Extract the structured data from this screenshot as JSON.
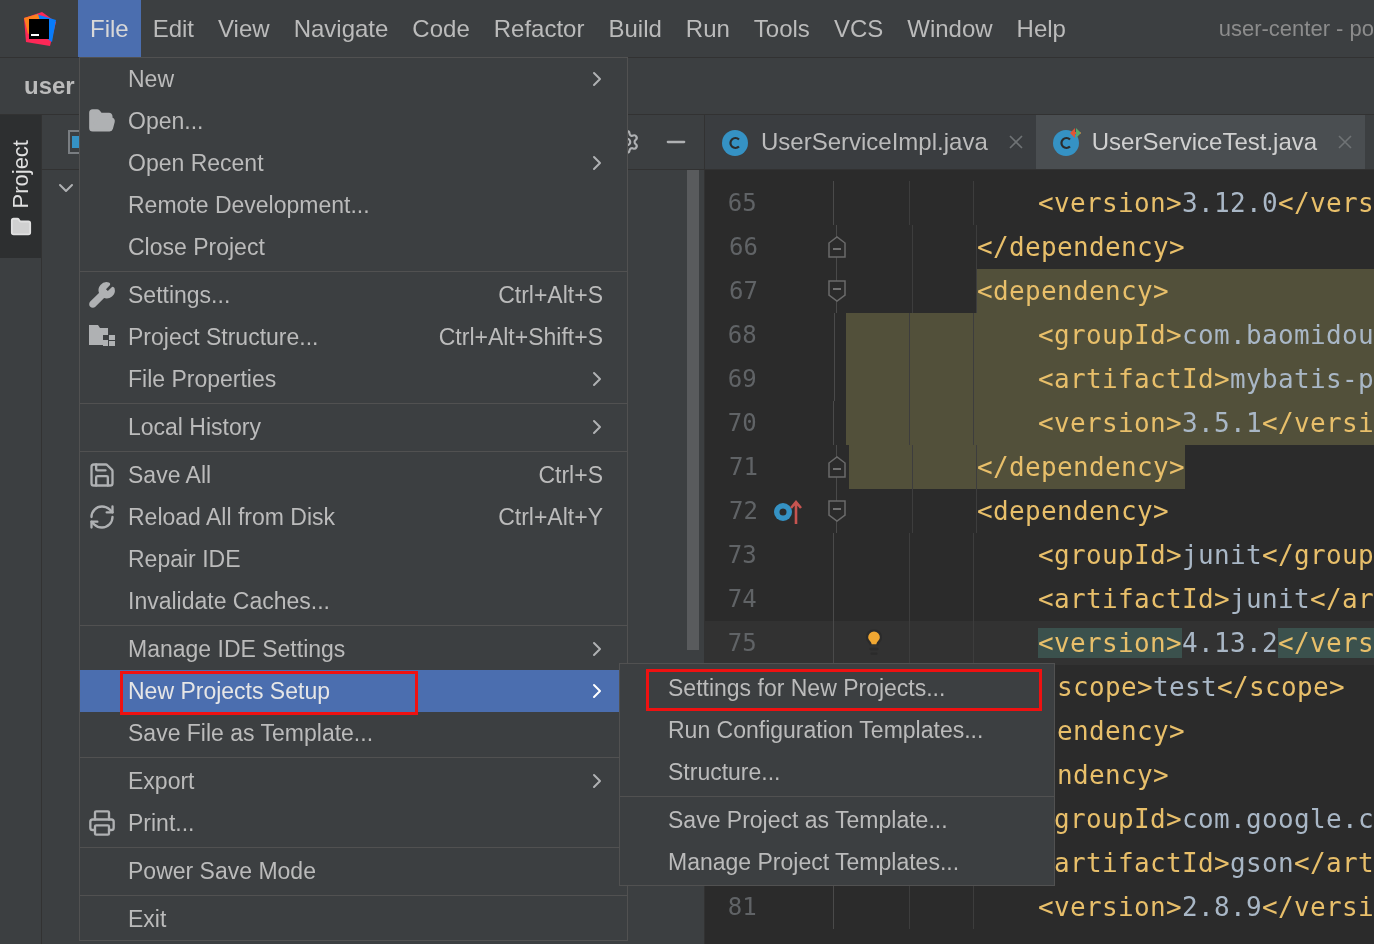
{
  "window": {
    "title": "user-center - po"
  },
  "menubar": [
    {
      "label": "File",
      "selected": true
    },
    {
      "label": "Edit",
      "selected": false
    },
    {
      "label": "View",
      "selected": false
    },
    {
      "label": "Navigate",
      "selected": false
    },
    {
      "label": "Code",
      "selected": false
    },
    {
      "label": "Refactor",
      "selected": false
    },
    {
      "label": "Build",
      "selected": false
    },
    {
      "label": "Run",
      "selected": false
    },
    {
      "label": "Tools",
      "selected": false
    },
    {
      "label": "VCS",
      "selected": false
    },
    {
      "label": "Window",
      "selected": false
    },
    {
      "label": "Help",
      "selected": false
    }
  ],
  "breadcrumb": "user",
  "tool_strip": [
    {
      "label": "Project",
      "selected": true
    }
  ],
  "editor_tabs": [
    {
      "label": "UserServiceImpl.java",
      "selected": false
    },
    {
      "label": "UserServiceTest.java",
      "selected": true
    }
  ],
  "file_menu": [
    {
      "kind": "item",
      "label": "New",
      "submenu": true,
      "selected": false
    },
    {
      "kind": "item",
      "label": "Open...",
      "submenu": false,
      "selected": false
    },
    {
      "kind": "item",
      "label": "Open Recent",
      "submenu": true,
      "selected": false
    },
    {
      "kind": "item",
      "label": "Remote Development...",
      "submenu": false,
      "selected": false
    },
    {
      "kind": "item",
      "label": "Close Project",
      "submenu": false,
      "selected": false
    },
    {
      "kind": "separator"
    },
    {
      "kind": "item",
      "label": "Settings...",
      "shortcut": "Ctrl+Alt+S",
      "submenu": false,
      "selected": false
    },
    {
      "kind": "item",
      "label": "Project Structure...",
      "shortcut": "Ctrl+Alt+Shift+S",
      "submenu": false,
      "selected": false
    },
    {
      "kind": "item",
      "label": "File Properties",
      "submenu": true,
      "selected": false
    },
    {
      "kind": "separator"
    },
    {
      "kind": "item",
      "label": "Local History",
      "submenu": true,
      "selected": false
    },
    {
      "kind": "separator"
    },
    {
      "kind": "item",
      "label": "Save All",
      "shortcut": "Ctrl+S",
      "submenu": false,
      "selected": false
    },
    {
      "kind": "item",
      "label": "Reload All from Disk",
      "shortcut": "Ctrl+Alt+Y",
      "submenu": false,
      "selected": false
    },
    {
      "kind": "item",
      "label": "Repair IDE",
      "submenu": false,
      "selected": false
    },
    {
      "kind": "item",
      "label": "Invalidate Caches...",
      "submenu": false,
      "selected": false
    },
    {
      "kind": "separator"
    },
    {
      "kind": "item",
      "label": "Manage IDE Settings",
      "submenu": true,
      "selected": false
    },
    {
      "kind": "item",
      "label": "New Projects Setup",
      "submenu": true,
      "selected": true,
      "annotated": true
    },
    {
      "kind": "item",
      "label": "Save File as Template...",
      "submenu": false,
      "selected": false
    },
    {
      "kind": "separator"
    },
    {
      "kind": "item",
      "label": "Export",
      "submenu": true,
      "selected": false
    },
    {
      "kind": "item",
      "label": "Print...",
      "submenu": false,
      "selected": false
    },
    {
      "kind": "separator"
    },
    {
      "kind": "item",
      "label": "Power Save Mode",
      "submenu": false,
      "selected": false
    },
    {
      "kind": "separator"
    },
    {
      "kind": "item",
      "label": "Exit",
      "submenu": false,
      "selected": false
    }
  ],
  "submenu": [
    {
      "kind": "item",
      "label": "Settings for New Projects...",
      "annotated": true
    },
    {
      "kind": "item",
      "label": "Run Configuration Templates...",
      "annotated": false
    },
    {
      "kind": "item",
      "label": "Structure...",
      "annotated": false
    },
    {
      "kind": "separator"
    },
    {
      "kind": "item",
      "label": "Save Project as Template...",
      "annotated": false
    },
    {
      "kind": "item",
      "label": "Manage Project Templates...",
      "annotated": false
    }
  ],
  "editor": {
    "lines": [
      {
        "number": "65",
        "code": "            <version>3.12.0</vers",
        "kind": "plain",
        "fold_start": false,
        "fold_end": false,
        "override": false,
        "bulb": false
      },
      {
        "number": "66",
        "code": "        </dependency>",
        "kind": "plain",
        "fold_start": false,
        "fold_end": true,
        "override": false,
        "bulb": false
      },
      {
        "number": "67",
        "code": "        <dependency>",
        "kind": "block-start",
        "fold_start": true,
        "fold_end": false,
        "override": false,
        "bulb": false
      },
      {
        "number": "68",
        "code": "            <groupId>com.baomidou",
        "kind": "block",
        "fold_start": false,
        "fold_end": false,
        "override": false,
        "bulb": false
      },
      {
        "number": "69",
        "code": "            <artifactId>mybatis-p",
        "kind": "block",
        "fold_start": false,
        "fold_end": false,
        "override": false,
        "bulb": false
      },
      {
        "number": "70",
        "code": "            <version>3.5.1</versi",
        "kind": "block",
        "fold_start": false,
        "fold_end": false,
        "override": false,
        "bulb": false
      },
      {
        "number": "71",
        "code": "        </dependency>",
        "kind": "block-end",
        "fold_start": false,
        "fold_end": true,
        "override": false,
        "bulb": false
      },
      {
        "number": "72",
        "code": "        <dependency>",
        "kind": "plain",
        "fold_start": true,
        "fold_end": false,
        "override": true,
        "bulb": false
      },
      {
        "number": "73",
        "code": "            <groupId>junit</group",
        "kind": "plain",
        "fold_start": false,
        "fold_end": false,
        "override": false,
        "bulb": false
      },
      {
        "number": "74",
        "code": "            <artifactId>junit</ar",
        "kind": "plain",
        "fold_start": false,
        "fold_end": false,
        "override": false,
        "bulb": false
      },
      {
        "number": "75",
        "code": "            <version>4.13.2</vers",
        "kind": "caret",
        "fold_start": false,
        "fold_end": false,
        "override": false,
        "bulb": true
      },
      {
        "code": "             scope>test</scope>",
        "kind": "plain"
      },
      {
        "code": "             endency>",
        "kind": "plain"
      },
      {
        "code": "             ndency>",
        "kind": "plain"
      },
      {
        "code": "             groupId>com.google.c",
        "kind": "plain"
      },
      {
        "code": "             artifactId>gson</art",
        "kind": "plain"
      },
      {
        "number": "81",
        "code": "            <version>2.8.9</versi",
        "kind": "plain",
        "fold_start": false,
        "fold_end": false,
        "override": false,
        "bulb": false
      }
    ]
  }
}
